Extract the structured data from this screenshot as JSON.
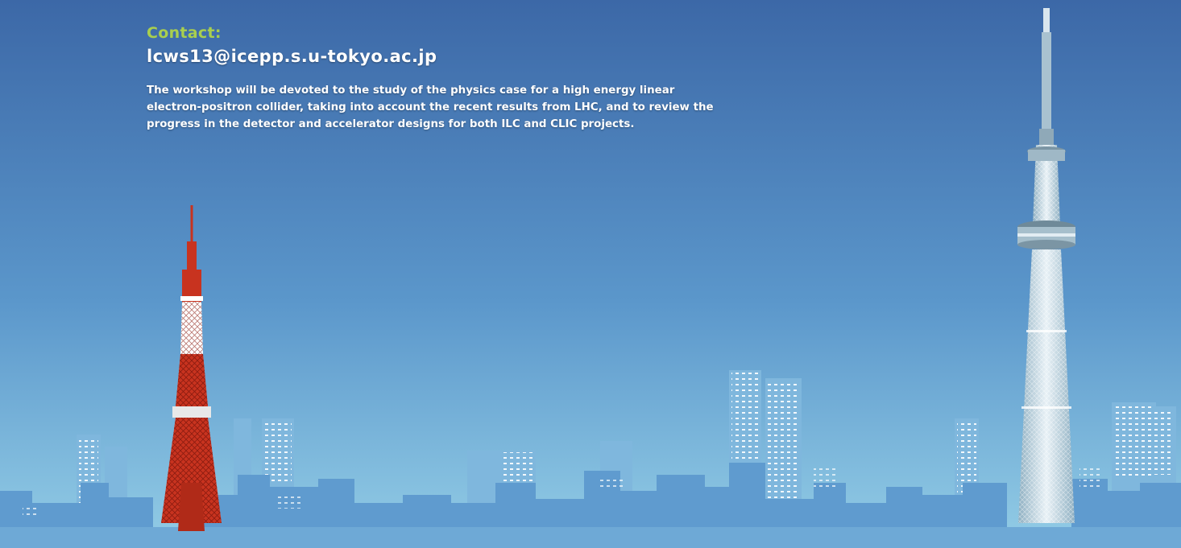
{
  "contact": {
    "label": "Contact:",
    "email": "lcws13@icepp.s.u-tokyo.ac.jp"
  },
  "description": "The workshop will be devoted to the study of the physics case for a high energy linear electron-positron collider, taking into account the recent results from LHC, and to review the progress in the detector and accelerator designs for both ILC and CLIC projects.",
  "colors": {
    "sky_top": "#3d6aa8",
    "sky_bottom": "#8ec8e4",
    "contact_label": "#a9cf4e",
    "tower_red": "#c8331f",
    "buildings": "#6aa3d2",
    "skytree": "#cfe0ea"
  },
  "illustration": {
    "left_landmark": "tokyo-tower-icon",
    "right_landmark": "tokyo-skytree-icon",
    "skyline": "city-skyline-icon"
  }
}
